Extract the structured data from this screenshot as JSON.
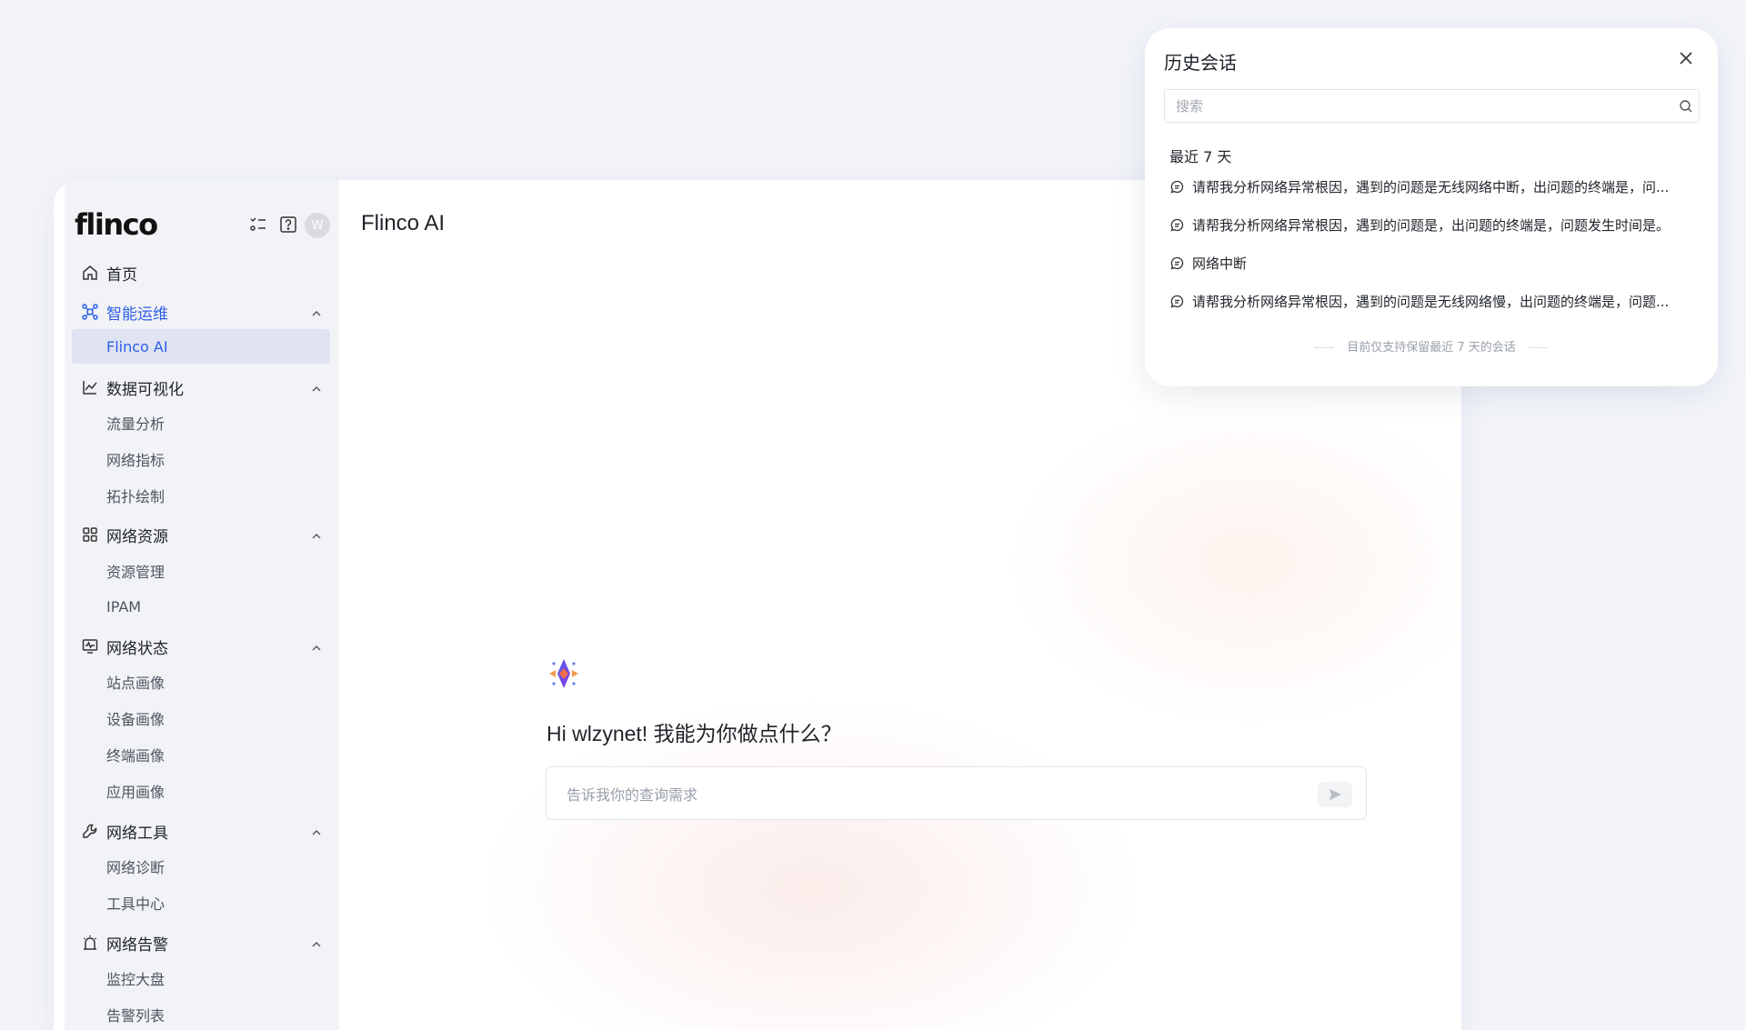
{
  "app": {
    "logo_text": "flinco",
    "avatar_initial": "W"
  },
  "sidebar": {
    "groups": [
      {
        "label": "首页",
        "icon": "home-icon",
        "active": false,
        "items": []
      },
      {
        "label": "智能运维",
        "icon": "ai-ops-icon",
        "active": true,
        "items": [
          "Flinco AI"
        ]
      },
      {
        "label": "数据可视化",
        "icon": "line-chart-icon",
        "active": false,
        "items": [
          "流量分析",
          "网络指标",
          "拓扑绘制"
        ]
      },
      {
        "label": "网络资源",
        "icon": "grid-icon",
        "active": false,
        "items": [
          "资源管理",
          "IPAM"
        ]
      },
      {
        "label": "网络状态",
        "icon": "monitor-icon",
        "active": false,
        "items": [
          "站点画像",
          "设备画像",
          "终端画像",
          "应用画像"
        ]
      },
      {
        "label": "网络工具",
        "icon": "wrench-icon",
        "active": false,
        "items": [
          "网络诊断",
          "工具中心"
        ]
      },
      {
        "label": "网络告警",
        "icon": "alarm-icon",
        "active": false,
        "items": [
          "监控大盘",
          "告警列表"
        ]
      }
    ],
    "selected_item": "Flinco AI"
  },
  "main": {
    "title": "Flinco AI",
    "greeting": "Hi wlzynet! 我能为你做点什么？",
    "query_placeholder": "告诉我你的查询需求",
    "query_value": ""
  },
  "history": {
    "title": "历史会话",
    "search_placeholder": "搜索",
    "section_label": "最近 7 天",
    "items": [
      "请帮我分析网络异常根因，遇到的问题是无线网络中断，出问题的终端是，问...",
      "请帮我分析网络异常根因，遇到的问题是，出问题的终端是，问题发生时间是。",
      "网络中断",
      "请帮我分析网络异常根因，遇到的问题是无线网络慢，出问题的终端是，问题..."
    ],
    "footer_note": "目前仅支持保留最近 7 天的会话"
  },
  "colors": {
    "accent": "#2f5fe8",
    "selected_bg": "#dfe3f2",
    "sidebar_bg": "#f2f3f6",
    "page_bg": "#f3f5fa"
  }
}
